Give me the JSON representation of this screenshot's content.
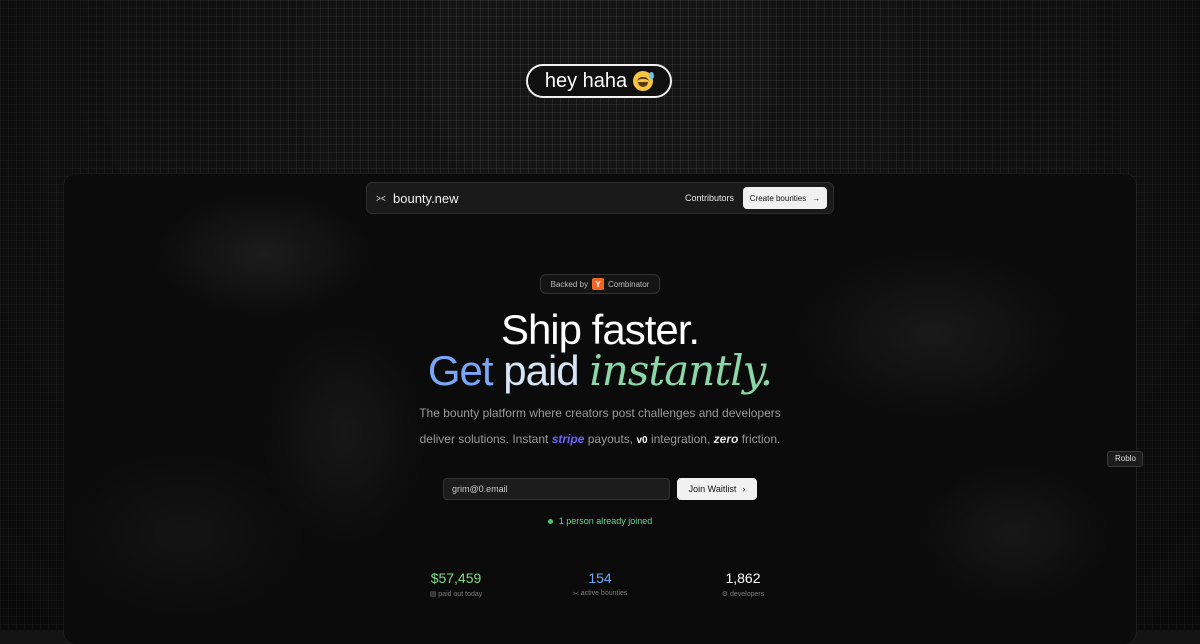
{
  "top_pill": {
    "text": "hey haha"
  },
  "navbar": {
    "brand": "bounty.new",
    "contributors": "Contributors",
    "cta": "Create bounties"
  },
  "badge": {
    "prefix": "Backed by",
    "yc_letter": "Y",
    "name": "Combinator"
  },
  "hero": {
    "line1": "Ship faster.",
    "line2_get": "Get",
    "line2_paid": "paid",
    "line2_instantly": "instantly."
  },
  "subtitle": {
    "line1": "The bounty platform where creators post challenges and developers",
    "line2_a": "deliver solutions. Instant",
    "stripe": "stripe",
    "line2_b": "payouts,",
    "v0": "v0",
    "line2_c": "integration,",
    "zero": "zero",
    "line2_d": "friction."
  },
  "waitlist": {
    "email_value": "grim@0.email",
    "button": "Join Waitlist",
    "joined": "1 person already joined"
  },
  "stats": [
    {
      "value": "$57,459",
      "label": "paid out today",
      "color": "#7fd98a"
    },
    {
      "value": "154",
      "label": "active bounties",
      "color": "#6fa8f5"
    },
    {
      "value": "1,862",
      "label": "developers",
      "color": "#ffffff"
    }
  ],
  "side_chip": "Roblo"
}
